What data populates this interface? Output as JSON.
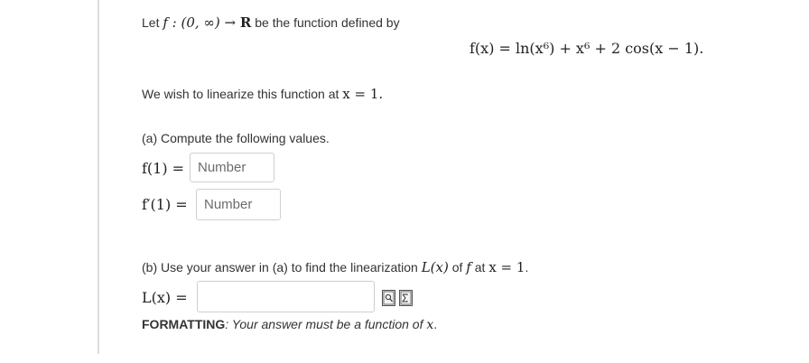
{
  "intro": {
    "prefix": "Let ",
    "func_signature": "f : (0, ∞) → ",
    "reals": "R",
    "suffix": " be the function defined by"
  },
  "equation": "f(x) = ln(x⁶) + x⁶ + 2 cos(x − 1).",
  "linearize": {
    "text": "We wish to linearize this function at ",
    "point": "x = 1."
  },
  "part_a": {
    "prompt": "(a) Compute the following values.",
    "f1_label": "f(1) =",
    "f1_value": "",
    "f1_placeholder": "Number",
    "fp1_label": "f′(1) =",
    "fp1_value": "",
    "fp1_placeholder": "Number"
  },
  "part_b": {
    "prompt_1": "(b) Use your answer in (a) to find the linearization ",
    "Lx": "L(x)",
    "prompt_2": " of ",
    "f": "f",
    "prompt_3": " at ",
    "point": "x = 1",
    "prompt_4": ".",
    "L_label": "L(x) =",
    "L_value": "",
    "formatting_label": "FORMATTING",
    "formatting_text": ": Your answer must be a function of ",
    "formatting_var": "x",
    "formatting_end": "."
  },
  "icons": [
    "preview-icon",
    "equation-editor-icon"
  ]
}
